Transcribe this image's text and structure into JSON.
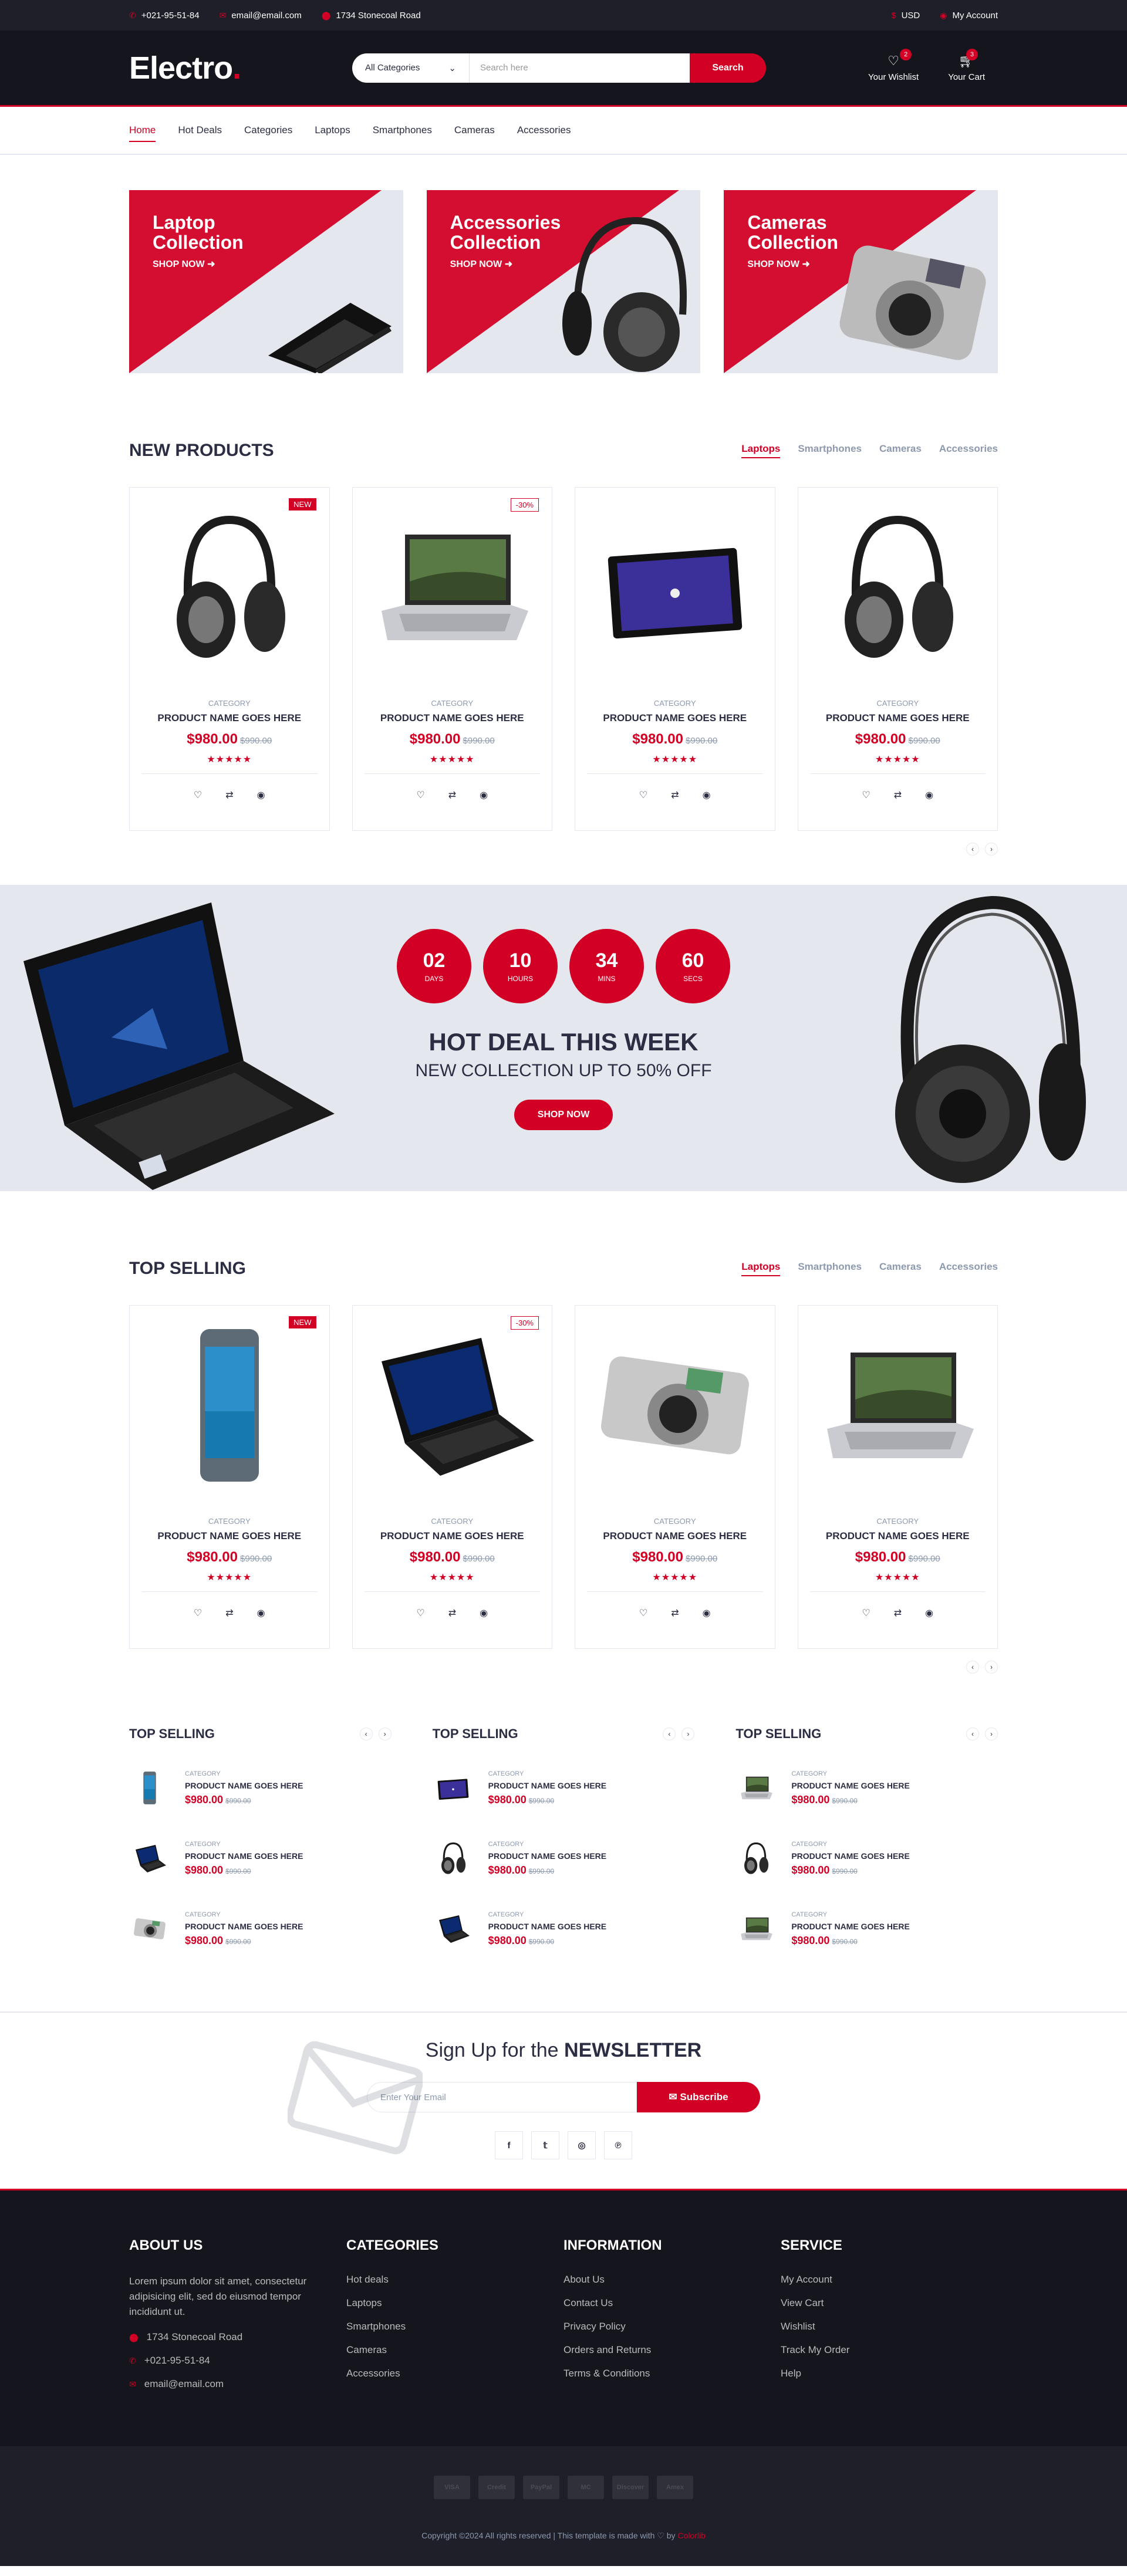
{
  "topbar": {
    "phone": "+021-95-51-84",
    "email": "email@email.com",
    "address": "1734 Stonecoal Road",
    "currency": "USD",
    "account": "My Account"
  },
  "header": {
    "logo": "Electro",
    "category_select": "All Categories",
    "search_placeholder": "Search here",
    "search_button": "Search",
    "wishlist_label": "Your Wishlist",
    "wishlist_qty": "2",
    "cart_label": "Your Cart",
    "cart_qty": "3"
  },
  "nav": [
    "Home",
    "Hot Deals",
    "Categories",
    "Laptops",
    "Smartphones",
    "Cameras",
    "Accessories"
  ],
  "collections": [
    {
      "title_1": "Laptop",
      "title_2": "Collection",
      "cta": "SHOP NOW"
    },
    {
      "title_1": "Accessories",
      "title_2": "Collection",
      "cta": "SHOP NOW"
    },
    {
      "title_1": "Cameras",
      "title_2": "Collection",
      "cta": "SHOP NOW"
    }
  ],
  "new_products": {
    "title": "NEW PRODUCTS",
    "tabs": [
      "Laptops",
      "Smartphones",
      "Cameras",
      "Accessories"
    ],
    "items": [
      {
        "badge": "NEW",
        "category": "CATEGORY",
        "name": "PRODUCT NAME GOES HERE",
        "price": "$980.00",
        "old_price": "$990.00",
        "image": "headphones"
      },
      {
        "badge": "-30%",
        "category": "CATEGORY",
        "name": "PRODUCT NAME GOES HERE",
        "price": "$980.00",
        "old_price": "$990.00",
        "image": "laptop"
      },
      {
        "badge": "",
        "category": "CATEGORY",
        "name": "PRODUCT NAME GOES HERE",
        "price": "$980.00",
        "old_price": "$990.00",
        "image": "tablet"
      },
      {
        "badge": "",
        "category": "CATEGORY",
        "name": "PRODUCT NAME GOES HERE",
        "price": "$980.00",
        "old_price": "$990.00",
        "image": "headphones"
      }
    ]
  },
  "hot_deal": {
    "days": "02",
    "days_label": "Days",
    "hours": "10",
    "hours_label": "Hours",
    "mins": "34",
    "mins_label": "Mins",
    "secs": "60",
    "secs_label": "Secs",
    "title": "HOT DEAL THIS WEEK",
    "subtitle": "NEW COLLECTION UP TO 50% OFF",
    "cta": "SHOP NOW"
  },
  "top_selling": {
    "title": "TOP SELLING",
    "tabs": [
      "Laptops",
      "Smartphones",
      "Cameras",
      "Accessories"
    ],
    "items": [
      {
        "badge": "NEW",
        "category": "CATEGORY",
        "name": "PRODUCT NAME GOES HERE",
        "price": "$980.00",
        "old_price": "$990.00",
        "image": "phone"
      },
      {
        "badge": "-30%",
        "category": "CATEGORY",
        "name": "PRODUCT NAME GOES HERE",
        "price": "$980.00",
        "old_price": "$990.00",
        "image": "laptop-dark"
      },
      {
        "badge": "",
        "category": "CATEGORY",
        "name": "PRODUCT NAME GOES HERE",
        "price": "$980.00",
        "old_price": "$990.00",
        "image": "camera"
      },
      {
        "badge": "",
        "category": "CATEGORY",
        "name": "PRODUCT NAME GOES HERE",
        "price": "$980.00",
        "old_price": "$990.00",
        "image": "laptop"
      }
    ]
  },
  "widgets": [
    {
      "title": "TOP SELLING",
      "items": [
        {
          "category": "CATEGORY",
          "name": "PRODUCT NAME GOES HERE",
          "price": "$980.00",
          "old_price": "$990.00",
          "image": "phone"
        },
        {
          "category": "CATEGORY",
          "name": "PRODUCT NAME GOES HERE",
          "price": "$980.00",
          "old_price": "$990.00",
          "image": "laptop-dark"
        },
        {
          "category": "CATEGORY",
          "name": "PRODUCT NAME GOES HERE",
          "price": "$980.00",
          "old_price": "$990.00",
          "image": "camera"
        }
      ]
    },
    {
      "title": "TOP SELLING",
      "items": [
        {
          "category": "CATEGORY",
          "name": "PRODUCT NAME GOES HERE",
          "price": "$980.00",
          "old_price": "$990.00",
          "image": "tablet"
        },
        {
          "category": "CATEGORY",
          "name": "PRODUCT NAME GOES HERE",
          "price": "$980.00",
          "old_price": "$990.00",
          "image": "headphones"
        },
        {
          "category": "CATEGORY",
          "name": "PRODUCT NAME GOES HERE",
          "price": "$980.00",
          "old_price": "$990.00",
          "image": "laptop-dark"
        }
      ]
    },
    {
      "title": "TOP SELLING",
      "items": [
        {
          "category": "CATEGORY",
          "name": "PRODUCT NAME GOES HERE",
          "price": "$980.00",
          "old_price": "$990.00",
          "image": "laptop"
        },
        {
          "category": "CATEGORY",
          "name": "PRODUCT NAME GOES HERE",
          "price": "$980.00",
          "old_price": "$990.00",
          "image": "headphones"
        },
        {
          "category": "CATEGORY",
          "name": "PRODUCT NAME GOES HERE",
          "price": "$980.00",
          "old_price": "$990.00",
          "image": "laptop"
        }
      ]
    }
  ],
  "newsletter": {
    "title_prefix": "Sign Up for the",
    "title_bold": "NEWSLETTER",
    "placeholder": "Enter Your Email",
    "button": "Subscribe"
  },
  "footer": {
    "about_title": "ABOUT US",
    "about_text": "Lorem ipsum dolor sit amet, consectetur adipisicing elit, sed do eiusmod tempor incididunt ut.",
    "address": "1734 Stonecoal Road",
    "phone": "+021-95-51-84",
    "email": "email@email.com",
    "categories_title": "CATEGORIES",
    "categories": [
      "Hot deals",
      "Laptops",
      "Smartphones",
      "Cameras",
      "Accessories"
    ],
    "information_title": "INFORMATION",
    "information": [
      "About Us",
      "Contact Us",
      "Privacy Policy",
      "Orders and Returns",
      "Terms & Conditions"
    ],
    "service_title": "SERVICE",
    "service": [
      "My Account",
      "View Cart",
      "Wishlist",
      "Track My Order",
      "Help"
    ],
    "payments": [
      "VISA",
      "Credit",
      "PayPal",
      "MC",
      "Discover",
      "Amex"
    ],
    "copyright": "Copyright ©2024 All rights reserved | This template is made with ♡ by",
    "brand": "Colorlib"
  },
  "colors": {
    "accent": "#d10024",
    "dark": "#15161d",
    "topbar": "#1e1f29",
    "light": "#e4e7ed"
  }
}
